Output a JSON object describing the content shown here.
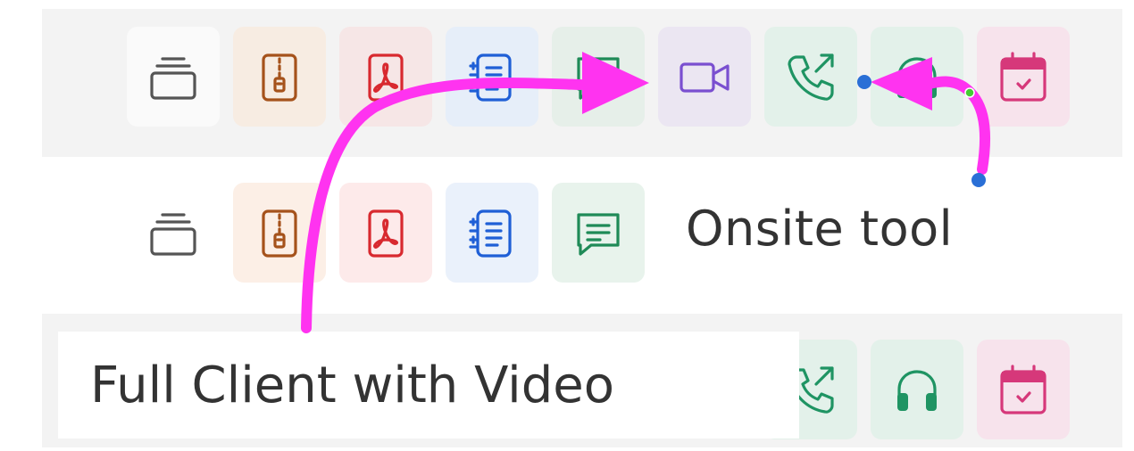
{
  "rows": [
    {
      "name": "row-1",
      "tiles": [
        {
          "icon": "stack-icon",
          "bg": "#fafafa",
          "fg": "#555555"
        },
        {
          "icon": "zip-file-icon",
          "bg": "#f7ece2",
          "fg": "#a5521b"
        },
        {
          "icon": "pdf-file-icon",
          "bg": "#f6e6e6",
          "fg": "#d8292f"
        },
        {
          "icon": "list-document-icon",
          "bg": "#e6eef9",
          "fg": "#1f5fd6"
        },
        {
          "icon": "chat-icon",
          "bg": "#e6efe9",
          "fg": "#1f8a57"
        },
        {
          "icon": "video-camera-icon",
          "bg": "#ebe6f2",
          "fg": "#7a4fd0"
        },
        {
          "icon": "phone-outgoing-icon",
          "bg": "#e3f1ea",
          "fg": "#1f9463"
        },
        {
          "icon": "headset-icon",
          "bg": "#e3f1ea",
          "fg": "#1f9463"
        },
        {
          "icon": "calendar-icon",
          "bg": "#f7e3ec",
          "fg": "#d6387a"
        }
      ]
    },
    {
      "name": "row-2",
      "tiles": [
        {
          "icon": "stack-icon",
          "bg": "#ffffff",
          "fg": "#555555"
        },
        {
          "icon": "zip-file-icon",
          "bg": "#fcefe6",
          "fg": "#a5521b"
        },
        {
          "icon": "pdf-file-icon",
          "bg": "#fdeaea",
          "fg": "#d8292f"
        },
        {
          "icon": "list-document-icon",
          "bg": "#eaf1fb",
          "fg": "#1f5fd6"
        },
        {
          "icon": "chat-icon",
          "bg": "#e8f3ec",
          "fg": "#1f8a57"
        }
      ]
    },
    {
      "name": "row-3",
      "tiles": [
        {
          "icon": "phone-outgoing-icon",
          "bg": "#e3f1ea",
          "fg": "#1f9463"
        },
        {
          "icon": "headset-icon",
          "bg": "#e3f1ea",
          "fg": "#1f9463"
        },
        {
          "icon": "calendar-icon",
          "bg": "#f7e3ec",
          "fg": "#d6387a"
        }
      ]
    }
  ],
  "labels": {
    "onsite": "Onsite tool",
    "full_client": "Full Client with Video"
  },
  "arrows": {
    "color": "#ff33f0",
    "handle_color": "#2a6fd6",
    "handle_alt_color": "#44cc33"
  }
}
